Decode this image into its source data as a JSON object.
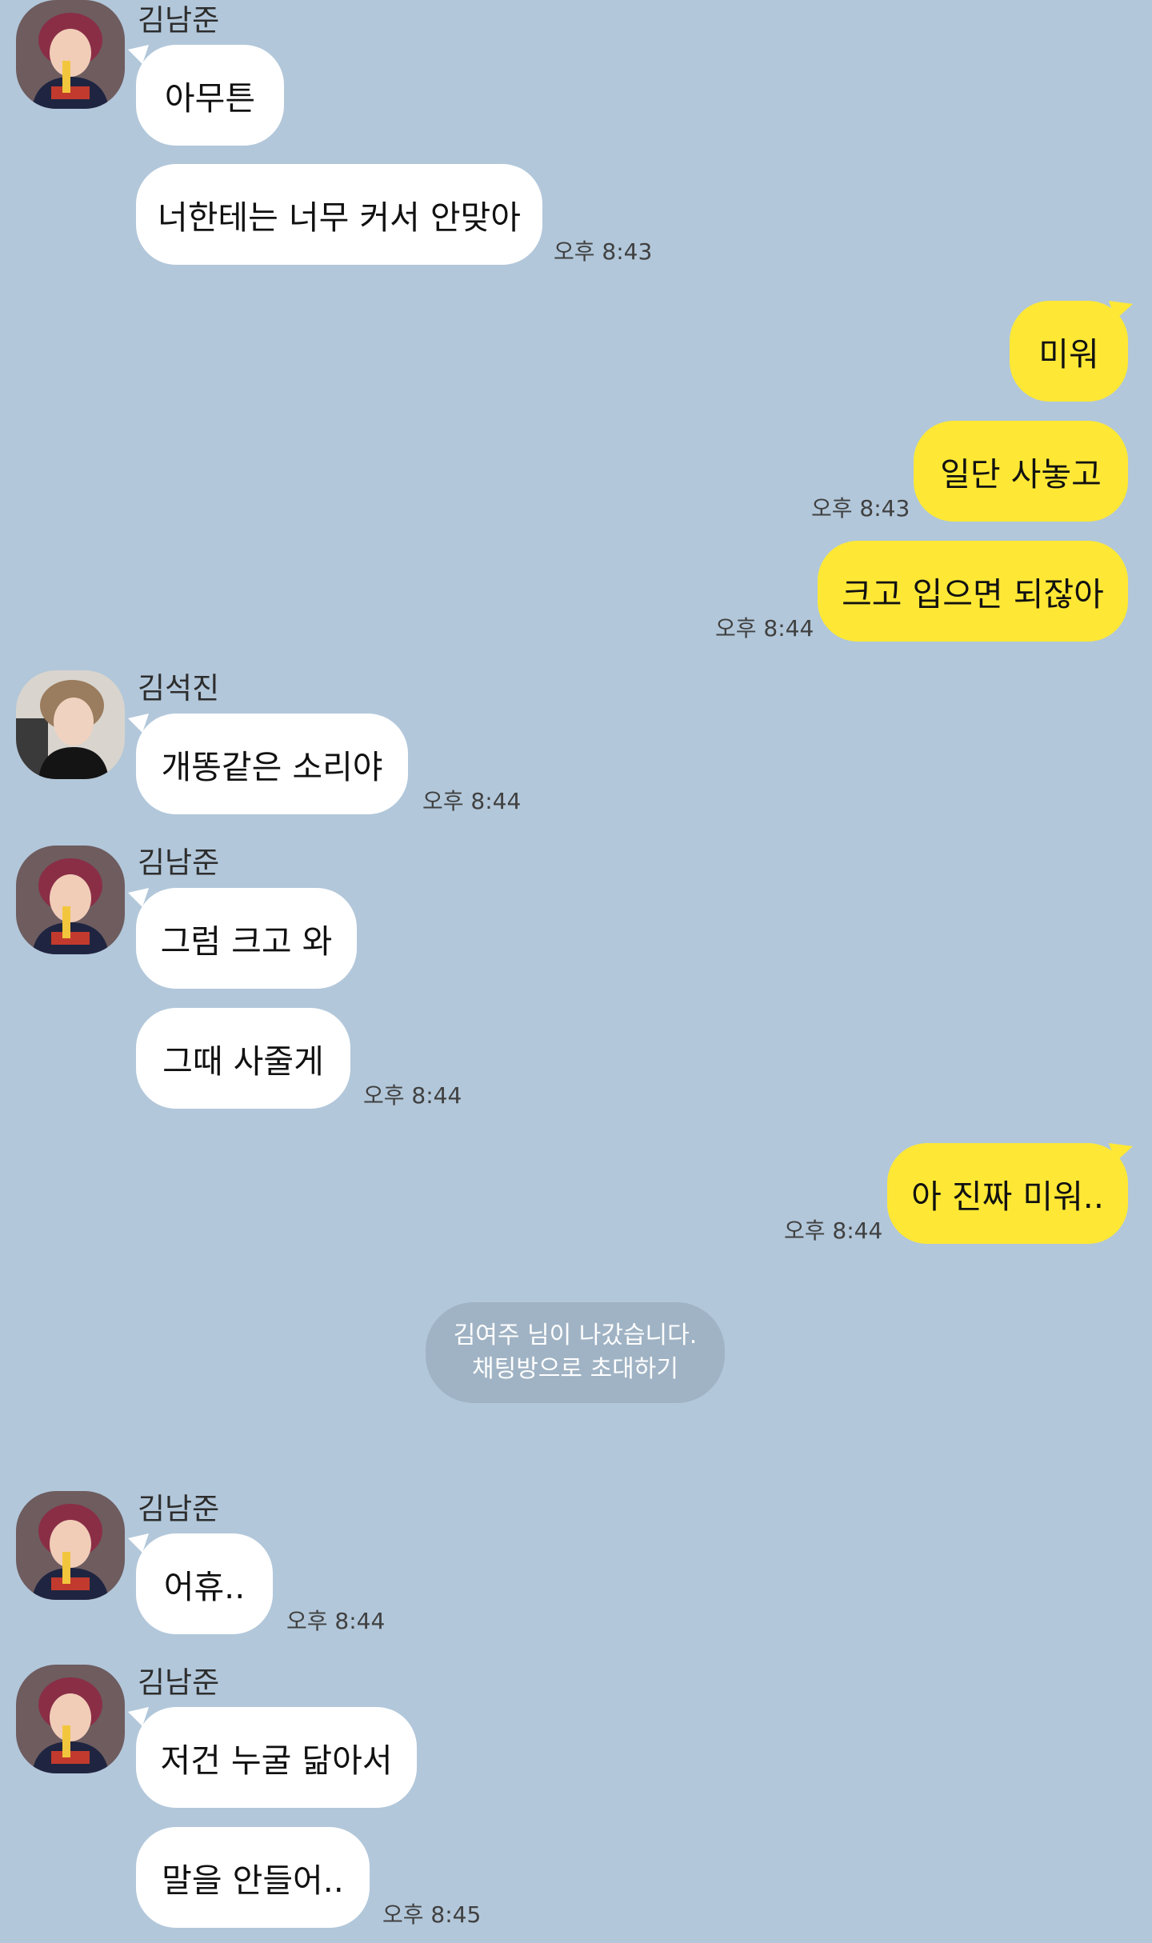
{
  "colors": {
    "background": "#b2c7da",
    "incoming_bubble": "#ffffff",
    "outgoing_bubble": "#fee835",
    "notice_bg": "#a0b3c4"
  },
  "senders": {
    "namjoon": "김남준",
    "seokjin": "김석진"
  },
  "messages": [
    {
      "text": "아무튼"
    },
    {
      "text": "너한테는 너무 커서 안맞아",
      "time": "오후 8:43"
    },
    {
      "text": "미워"
    },
    {
      "text": "일단 사놓고",
      "time": "오후 8:43"
    },
    {
      "text": "크고 입으면 되잖아",
      "time": "오후 8:44"
    },
    {
      "text": "개똥같은 소리야",
      "time": "오후 8:44"
    },
    {
      "text": "그럼 크고 와"
    },
    {
      "text": "그때 사줄게",
      "time": "오후 8:44"
    },
    {
      "text": "아 진짜 미워..",
      "time": "오후 8:44"
    },
    {
      "text": "어휴..",
      "time": "오후 8:44"
    },
    {
      "text": "저건 누굴 닮아서"
    },
    {
      "text": "말을 안들어..",
      "time": "오후 8:45"
    }
  ],
  "notice": {
    "line1": "김여주 님이 나갔습니다.",
    "line2": "채팅방으로 초대하기"
  }
}
